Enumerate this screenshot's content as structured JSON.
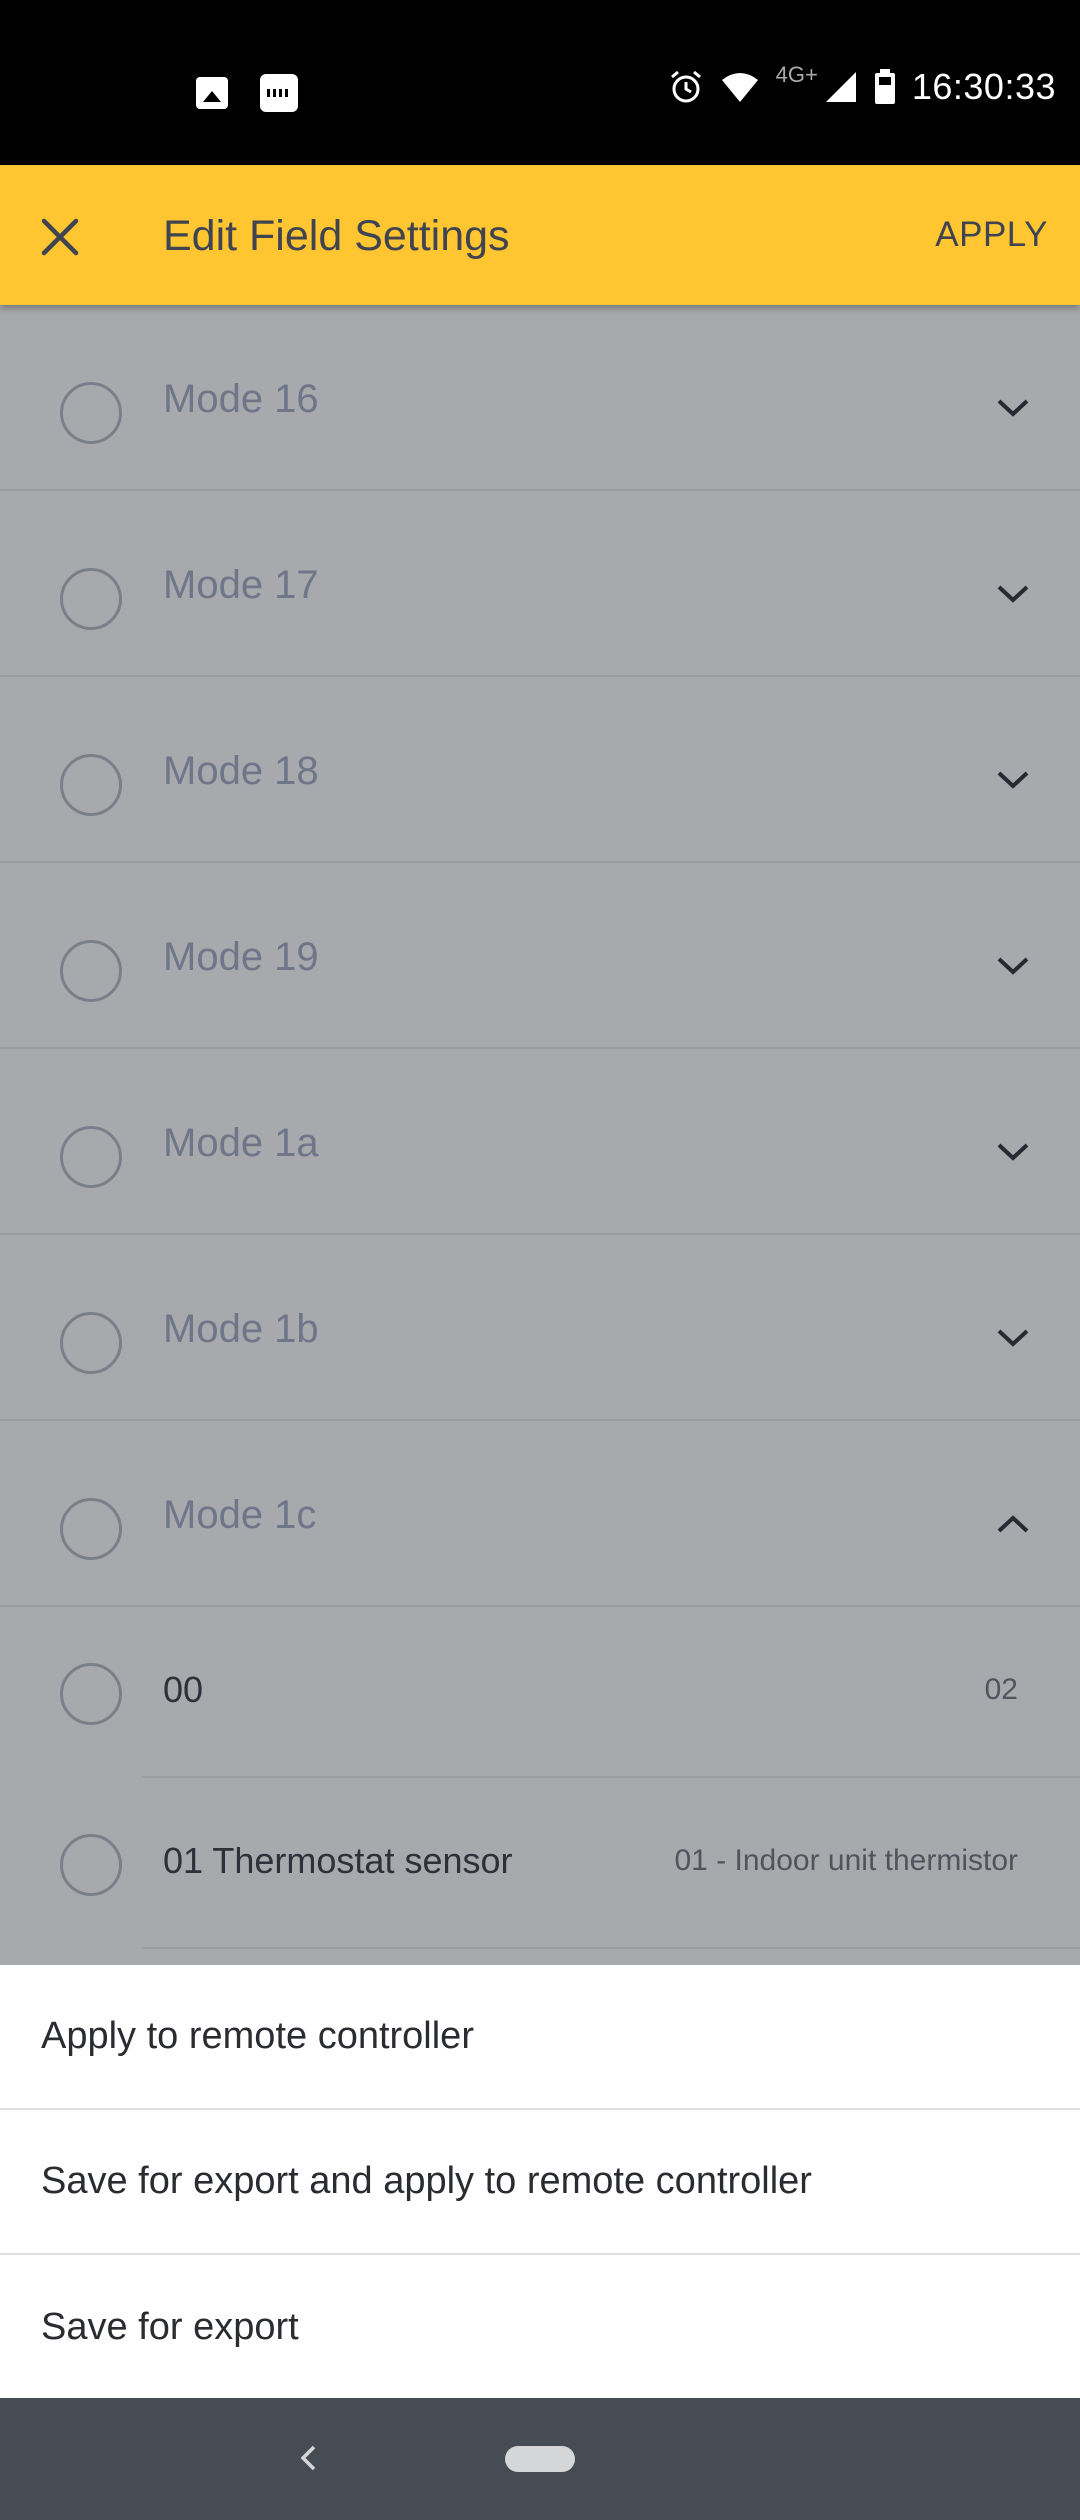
{
  "status_bar": {
    "network": "4G+",
    "time": "16:30:33"
  },
  "app_bar": {
    "title": "Edit Field Settings",
    "apply_label": "APPLY"
  },
  "modes": [
    {
      "label": "Mode 16",
      "expanded": false
    },
    {
      "label": "Mode 17",
      "expanded": false
    },
    {
      "label": "Mode 18",
      "expanded": false
    },
    {
      "label": "Mode 19",
      "expanded": false
    },
    {
      "label": "Mode 1a",
      "expanded": false
    },
    {
      "label": "Mode 1b",
      "expanded": false
    },
    {
      "label": "Mode 1c",
      "expanded": true
    }
  ],
  "sub_items": [
    {
      "label": "00",
      "value": "02"
    },
    {
      "label": "01 Thermostat sensor",
      "value": "01 - Indoor unit thermistor"
    }
  ],
  "bottom_sheet": {
    "options": [
      "Apply to remote controller",
      "Save for export and apply to remote controller",
      "Save for export"
    ]
  },
  "colors": {
    "accent": "#ffc632",
    "overlay": "#a8a9ac",
    "nav_bar": "#454c53"
  }
}
